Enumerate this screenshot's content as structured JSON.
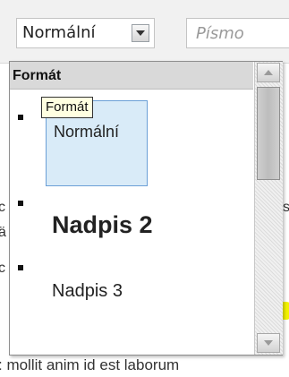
{
  "toolbar": {
    "format_combo_value": "Normální",
    "font_combo_placeholder": "Písmo"
  },
  "editor": {
    "bottom_text": ": mollit anim id est laborum"
  },
  "format_panel": {
    "header_title": "Formát",
    "tooltip": "Formát",
    "items": [
      {
        "label": "Normální",
        "selected": true
      },
      {
        "label": "Nadpis 2",
        "selected": false
      },
      {
        "label": "Nadpis 3",
        "selected": false
      }
    ]
  },
  "colors": {
    "toolbar_bg": "#f1f1f1",
    "panel_header_bg": "#d9d9d9",
    "selected_item_bg": "#d9ebf8",
    "selected_item_border": "#6b9fd6",
    "tooltip_bg": "#ffffe1",
    "highlight_yellow": "#f3f200"
  }
}
